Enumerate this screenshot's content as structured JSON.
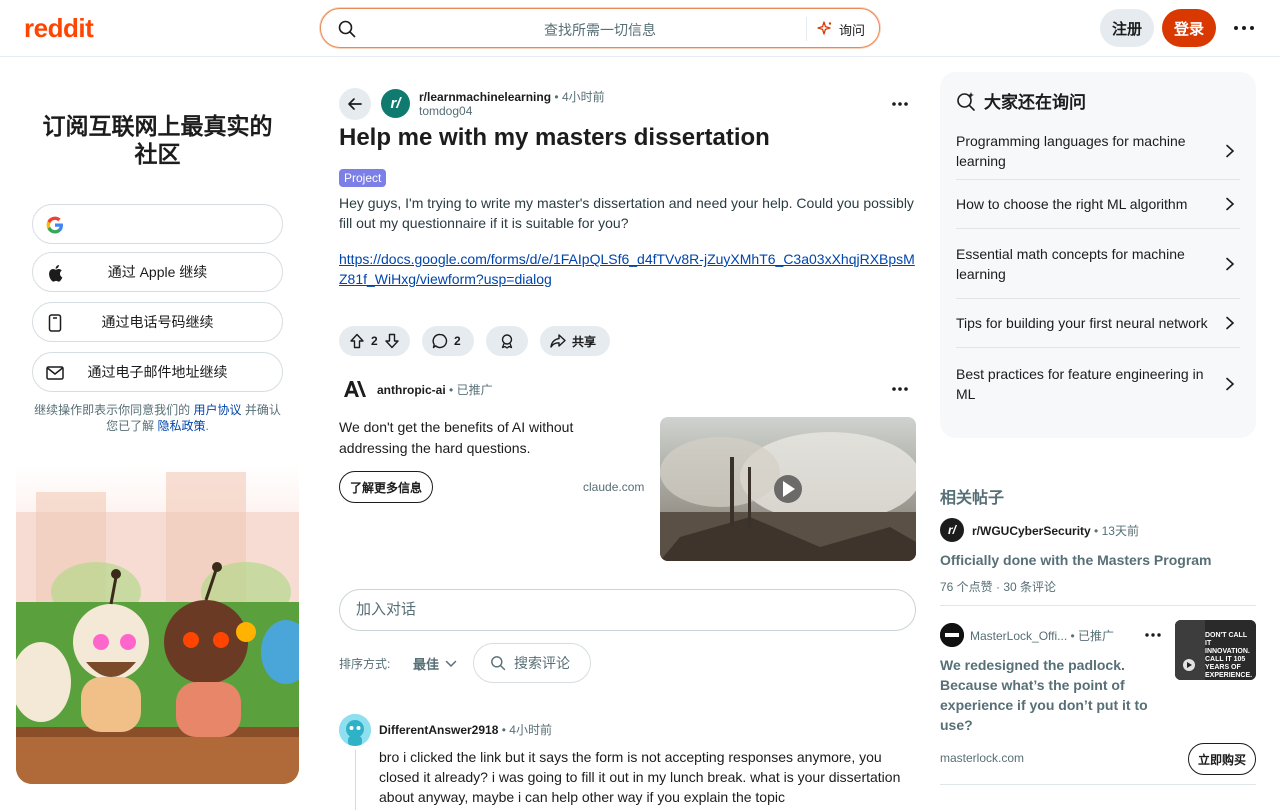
{
  "header": {
    "logo": "reddit",
    "search_placeholder": "查找所需一切信息",
    "ask_label": "询问",
    "signup_label": "注册",
    "login_label": "登录"
  },
  "left": {
    "title": "订阅互联网上最真实的社区",
    "apple_label": "通过 Apple 继续",
    "phone_label": "通过电话号码继续",
    "email_label": "通过电子邮件地址继续",
    "legal_prefix": "继续操作即表示你同意我们的",
    "user_agreement": "用户协议",
    "legal_mid": "并确认您已了解",
    "privacy_policy": "隐私政策",
    "legal_suffix": "."
  },
  "post": {
    "subreddit": "r/learnmachinelearning",
    "time": "4小时前",
    "author": "tomdog04",
    "title": "Help me with my masters dissertation",
    "flair": "Project",
    "body": "Hey guys, I'm trying to write my master's dissertation and need your help. Could you possibly fill out my questionnaire if it is suitable for you?",
    "link": "https://docs.google.com/forms/d/e/1FAIpQLSf6_d4fTVv8R-jZuyXMhT6_C3a03xXhqjRXBpsMZ81f_WiHxg/viewform?usp=dialog",
    "votes": "2",
    "comments": "2",
    "share_label": "共享"
  },
  "ad": {
    "advertiser": "anthropic-ai",
    "promoted": "已推广",
    "text": "We don't get the benefits of AI without addressing the hard questions.",
    "cta": "了解更多信息",
    "domain": "claude.com"
  },
  "comments_section": {
    "input_placeholder": "加入对话",
    "sort_label": "排序方式:",
    "sort_value": "最佳",
    "search_placeholder": "搜索评论"
  },
  "comment": {
    "user": "DifferentAnswer2918",
    "time": "4小时前",
    "text": "bro i clicked the link but it says the form is not accepting responses anymore, you closed it already? i was going to fill it out in my lunch break. what is your dissertation about anyway, maybe i can help other way if you explain the topic"
  },
  "right": {
    "title": "大家还在询问",
    "items": [
      "Programming languages for machine learning",
      "How to choose the right ML algorithm",
      "Essential math concepts for machine learning",
      "Tips for building your first neural network",
      "Best practices for feature engineering in ML"
    ]
  },
  "related": {
    "title": "相关帖子",
    "post1": {
      "subreddit": "r/WGUCyberSecurity",
      "time": "13天前",
      "title": "Officially done with the Masters Program",
      "upvotes": "76 个点赞",
      "comments": "30 条评论"
    },
    "ad2": {
      "advertiser": "MasterLock_Offi...",
      "promoted": "已推广",
      "title": "We redesigned the padlock. Because what’s the point of experience if you don’t put it to use?",
      "domain": "masterlock.com",
      "cta": "立即购买",
      "img_text": "DON'T CALL IT INNOVATION. CALL IT 105 YEARS OF EXPERIENCE."
    }
  },
  "colors": {
    "brand": "#ff4500",
    "login": "#d93900",
    "link": "#0045ac",
    "flair": "#7b7fe6"
  }
}
